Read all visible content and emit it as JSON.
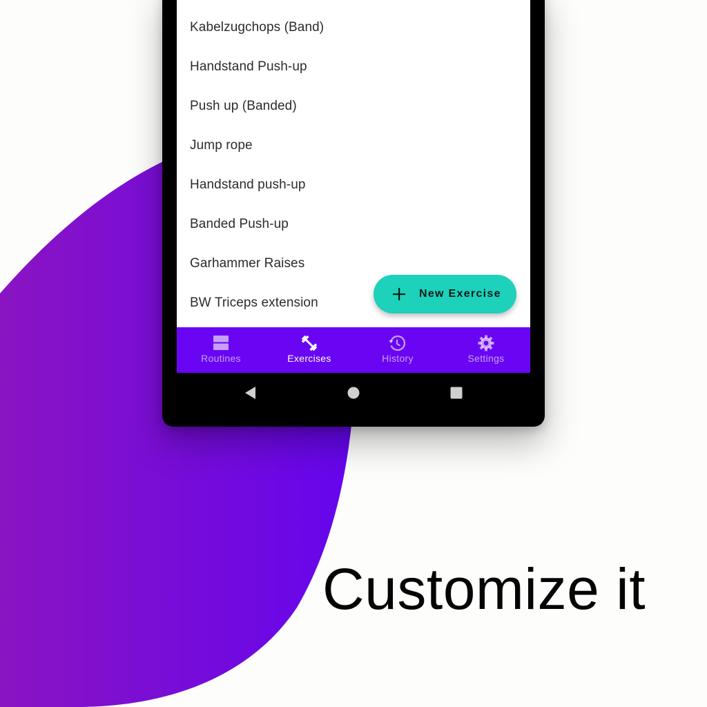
{
  "exercises": [
    "Kabelzugchops (Band)",
    "Handstand Push-up",
    "Push up (Banded)",
    "Jump rope",
    "Handstand push-up",
    "Banded Push-up",
    "Garhammer Raises",
    "BW Triceps extension"
  ],
  "fab": {
    "label": "New Exercise",
    "icon": "plus-icon"
  },
  "bottom_nav": {
    "items": [
      {
        "label": "Routines",
        "icon": "routines-icon",
        "active": false
      },
      {
        "label": "Exercises",
        "icon": "dumbbell-icon",
        "active": true
      },
      {
        "label": "History",
        "icon": "history-icon",
        "active": false
      },
      {
        "label": "Settings",
        "icon": "gear-icon",
        "active": false
      }
    ]
  },
  "system_nav": {
    "back": "back-icon",
    "home": "home-icon",
    "recents": "recents-icon"
  },
  "headline": "Customize it",
  "colors": {
    "accent_purple": "#6a05f4",
    "fab_teal": "#1dd1bb",
    "blob_left": "#8a14c2",
    "blob_right": "#6505ee"
  }
}
